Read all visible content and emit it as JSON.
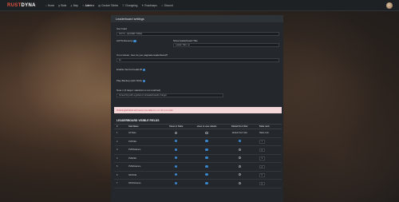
{
  "brand": {
    "part1": "RUST",
    "part2": "DYNA"
  },
  "nav": [
    {
      "label": "Home",
      "icon": "home-icon"
    },
    {
      "label": "Stats",
      "icon": "stats-icon"
    },
    {
      "label": "Map",
      "icon": "map-icon"
    },
    {
      "label": "Admin ▾",
      "icon": "admin-icon",
      "active": true
    },
    {
      "label": "Custom Tables",
      "icon": "table-icon"
    },
    {
      "label": "Changelog",
      "icon": "changelog-icon"
    },
    {
      "label": "Roadmaps",
      "icon": "roadmap-icon"
    },
    {
      "label": "Discord",
      "icon": "discord-icon"
    }
  ],
  "panel_title": "Leaderboard settings",
  "form": {
    "sort_by_label": "Sort Field",
    "sort_by_value": "Kill TG - LEADER TABLE",
    "auto_reverse_label": "AUTO-Reverse",
    "show_title_label": "Show leaderboard Title",
    "show_title_value": "Leader Tabl..ne",
    "default_page_label": "If not shown, how do you paginate leaderboard?",
    "default_page_value": "11",
    "enable_label": "Enable ItemList leaderB",
    "play_label": "Play Backup (with Shift)",
    "notes_label": "Note 1 (if target: statistics is not matched)",
    "notes_value": "ScreenTop with a global on all leaderboards if target"
  },
  "alert": "Ordering/all fields with same row-table to x or <br or to rank",
  "table_title": "LEADERBOARD VISIBLE FIELDS",
  "columns": [
    "#",
    "Stat Name",
    "Show in Table",
    "show in user details",
    "Default Sort Stat",
    "Table rank"
  ],
  "rows": [
    {
      "num": "1",
      "name": "All Stats",
      "show_table": false,
      "show_user": false,
      "default_sort": true,
      "rank": "Table rank",
      "default_text": "Default Sort Stat"
    },
    {
      "num": "2",
      "name": "PVPKills",
      "show_table": true,
      "show_user": true,
      "default_sort": true,
      "rank": "1"
    },
    {
      "num": "3",
      "name": "PVPDistance",
      "show_table": true,
      "show_user": true,
      "default_sort": false,
      "rank": "2"
    },
    {
      "num": "4",
      "name": "PVEKills",
      "show_table": true,
      "show_user": true,
      "default_sort": false,
      "rank": "3"
    },
    {
      "num": "5",
      "name": "PVEDistance",
      "show_table": true,
      "show_user": true,
      "default_sort": false,
      "rank": "2"
    },
    {
      "num": "6",
      "name": "NPCKills",
      "show_table": true,
      "show_user": true,
      "default_sort": false,
      "rank": "5"
    },
    {
      "num": "7",
      "name": "NPCDistance",
      "show_table": true,
      "show_user": true,
      "default_sort": false,
      "rank": "6"
    }
  ],
  "colors": {
    "accent": "#3a86cf",
    "brand_red": "#e0533e",
    "panel": "#24282c",
    "alert_bg": "#f4d7d9"
  }
}
